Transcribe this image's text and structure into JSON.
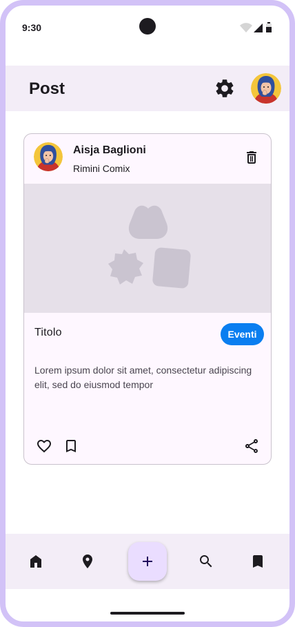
{
  "status_bar": {
    "time": "9:30",
    "icons": [
      "wifi-icon",
      "signal-icon",
      "battery-icon"
    ]
  },
  "app_bar": {
    "title": "Post",
    "settings_icon": "gear-icon",
    "avatar": "user-avatar"
  },
  "post": {
    "author": "Aisja Baglioni",
    "subhead": "Rimini Comix",
    "title": "Titolo",
    "tag": "Eventi",
    "body": "Lorem ipsum dolor sit amet, consectetur adipiscing elit, sed do eiusmod tempor",
    "actions": [
      "heart-icon",
      "bookmark-outline-icon",
      "share-icon"
    ],
    "delete_icon": "trash-icon",
    "media_placeholder_icon": "shapes-placeholder-icon"
  },
  "bottom_nav": {
    "items": [
      "home-icon",
      "location-pin-icon",
      "add-icon",
      "search-icon",
      "bookmark-icon"
    ]
  },
  "colors": {
    "frame": "#d2c2f7",
    "surface_container": "#f3edf7",
    "card_background": "#fef7ff",
    "media_background": "#e6e0e9",
    "chip": "#0a7ef0",
    "fab": "#eaddff",
    "text": "#1d1b20"
  }
}
